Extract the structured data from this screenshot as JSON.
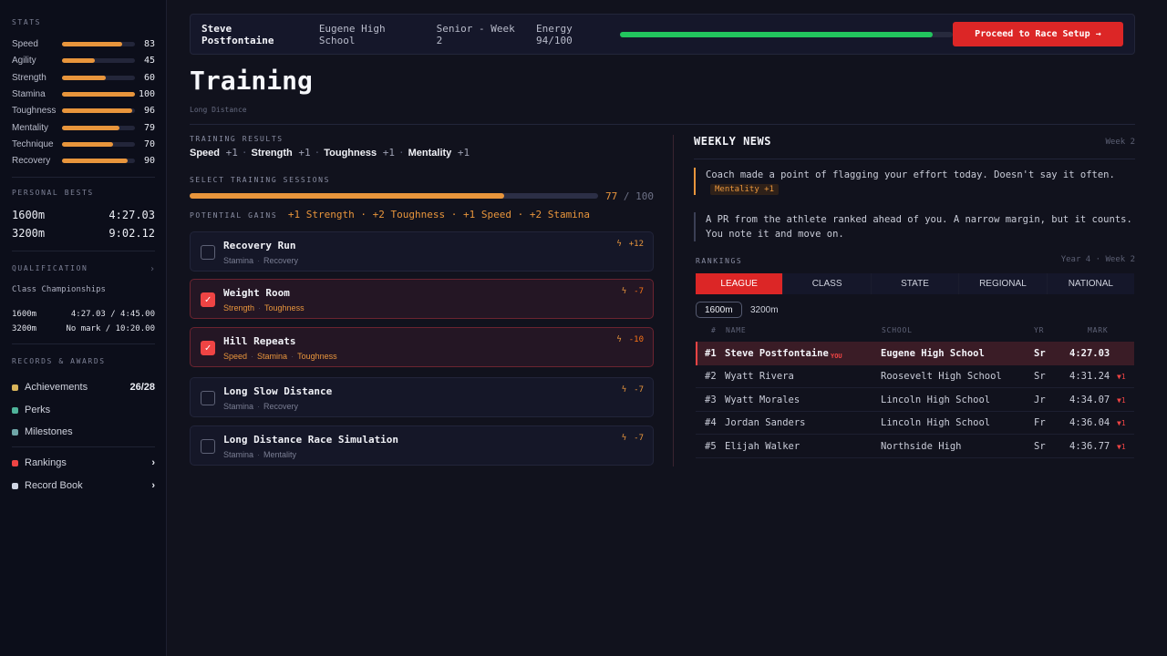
{
  "sidebar": {
    "stats_heading": "STATS",
    "stats": [
      {
        "name": "Speed",
        "value": 83,
        "fill": 0.83
      },
      {
        "name": "Agility",
        "value": 45,
        "fill": 0.45
      },
      {
        "name": "Strength",
        "value": 60,
        "fill": 0.6
      },
      {
        "name": "Stamina",
        "value": 100,
        "fill": 1.0
      },
      {
        "name": "Toughness",
        "value": 96,
        "fill": 0.96
      },
      {
        "name": "Mentality",
        "value": 79,
        "fill": 0.79
      },
      {
        "name": "Technique",
        "value": 70,
        "fill": 0.7
      },
      {
        "name": "Recovery",
        "value": 90,
        "fill": 0.9
      }
    ],
    "pb_heading": "PERSONAL BESTS",
    "pbs": [
      {
        "event": "1600m",
        "time": "4:27.03"
      },
      {
        "event": "3200m",
        "time": "9:02.12"
      }
    ],
    "qual_heading": "QUALIFICATION",
    "qual_chevron": "›",
    "qual_event": "Class Championships",
    "quals": [
      {
        "event": "1600m",
        "mark": "4:27.03 / 4:45.00"
      },
      {
        "event": "3200m",
        "mark": "No mark / 10:20.00"
      }
    ],
    "records_heading": "RECORDS & AWARDS",
    "records": [
      {
        "label": "Achievements",
        "right": "26/28",
        "color": "#d9b45a"
      },
      {
        "label": "Perks",
        "right": "",
        "color": "#4fb39a"
      },
      {
        "label": "Milestones",
        "right": "",
        "color": "#6fa6a8"
      }
    ],
    "links": [
      {
        "label": "Rankings",
        "right": "›",
        "color": "#ef4444"
      },
      {
        "label": "Record Book",
        "right": "›",
        "color": "#cfd5e3"
      }
    ]
  },
  "topbar": {
    "name": "Steve Postfontaine",
    "school": "Eugene High School",
    "term": "Senior - Week 2",
    "energy_label": "Energy 94/100",
    "energy_fraction": 0.94,
    "proceed_label": "Proceed to Race Setup →"
  },
  "page": {
    "title": "Training",
    "subtitle": "Long Distance"
  },
  "training_results": {
    "heading": "TRAINING RESULTS",
    "items": [
      {
        "stat": "Speed",
        "delta": "+1"
      },
      {
        "stat": "Strength",
        "delta": "+1"
      },
      {
        "stat": "Toughness",
        "delta": "+1"
      },
      {
        "stat": "Mentality",
        "delta": "+1"
      }
    ],
    "separator": "·"
  },
  "sessions": {
    "heading": "SELECT TRAINING SESSIONS",
    "current": "77",
    "total": "/ 100",
    "fraction": 0.77,
    "gains_heading": "POTENTIAL GAINS",
    "gains": [
      "+1 Strength",
      "+2 Toughness",
      "+1 Speed",
      "+2 Stamina"
    ],
    "bolt": "ϟ",
    "items": [
      {
        "title": "Recovery Run",
        "tags": [
          "Stamina",
          "Recovery"
        ],
        "cost": "+12",
        "selected": false
      },
      {
        "title": "Weight Room",
        "tags": [
          "Strength",
          "Toughness"
        ],
        "cost": "-7",
        "selected": true
      },
      {
        "title": "Hill Repeats",
        "tags": [
          "Speed",
          "Stamina",
          "Toughness"
        ],
        "cost": "-10",
        "selected": true
      },
      {
        "title": "Long Slow Distance",
        "tags": [
          "Stamina",
          "Recovery"
        ],
        "cost": "-7",
        "selected": false
      },
      {
        "title": "Long Distance Race Simulation",
        "tags": [
          "Stamina",
          "Mentality"
        ],
        "cost": "-7",
        "selected": false
      }
    ],
    "check_mark": "✓"
  },
  "news": {
    "title": "WEEKLY NEWS",
    "week": "Week 2",
    "items": [
      {
        "text": "Coach made a point of flagging your effort today. Doesn't say it often.",
        "tag": "Mentality +1"
      },
      {
        "text": "A PR from the athlete ranked ahead of you. A narrow margin, but it counts. You note it and move on.",
        "tag": ""
      }
    ]
  },
  "rankings": {
    "heading": "RANKINGS",
    "period": "Year 4 · Week 2",
    "tabs": [
      "LEAGUE",
      "CLASS",
      "STATE",
      "REGIONAL",
      "NATIONAL"
    ],
    "active_tab": 0,
    "distances": [
      "1600m",
      "3200m"
    ],
    "active_distance": 0,
    "columns": {
      "rank": "#",
      "name": "NAME",
      "school": "SCHOOL",
      "yr": "YR",
      "mark": "MARK"
    },
    "you_label": "YOU",
    "trend_down": "▼1",
    "rows": [
      {
        "rank": "#1",
        "name": "Steve Postfontaine",
        "school": "Eugene High School",
        "yr": "Sr",
        "mark": "4:27.03",
        "me": true,
        "trend": ""
      },
      {
        "rank": "#2",
        "name": "Wyatt Rivera",
        "school": "Roosevelt High School",
        "yr": "Sr",
        "mark": "4:31.24",
        "me": false,
        "trend": "▼1"
      },
      {
        "rank": "#3",
        "name": "Wyatt Morales",
        "school": "Lincoln High School",
        "yr": "Jr",
        "mark": "4:34.07",
        "me": false,
        "trend": "▼1"
      },
      {
        "rank": "#4",
        "name": "Jordan Sanders",
        "school": "Lincoln High School",
        "yr": "Fr",
        "mark": "4:36.04",
        "me": false,
        "trend": "▼1"
      },
      {
        "rank": "#5",
        "name": "Elijah Walker",
        "school": "Northside High",
        "yr": "Sr",
        "mark": "4:36.77",
        "me": false,
        "trend": "▼1"
      }
    ]
  }
}
